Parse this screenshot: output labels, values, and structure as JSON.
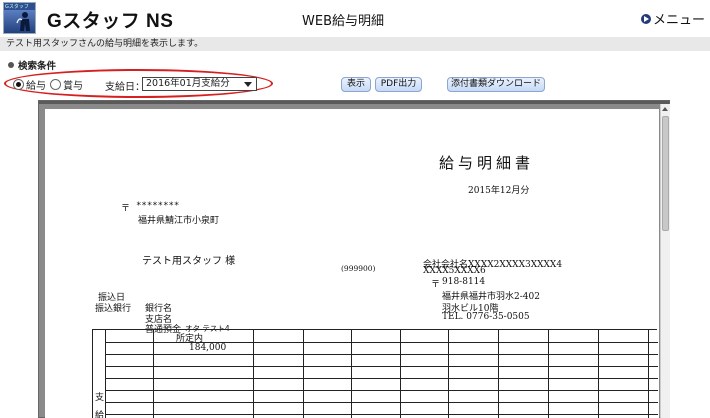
{
  "header": {
    "logo_caption": "Gスタッフ",
    "app_title": "Gスタッフ NS",
    "page_title": "WEB給与明細",
    "menu_label": "メニュー"
  },
  "info_text": "テスト用スタッフさんの給与明細を表示します。",
  "search": {
    "title": "検索条件",
    "radio_salary": "給与",
    "radio_bonus": "賞与",
    "selected": "salary",
    "date_label": "支給日：",
    "date_value": "2016年01月支給分",
    "buttons": {
      "show": "表示",
      "pdf": "PDF出力",
      "download": "添付書類ダウンロード"
    }
  },
  "document": {
    "title": "給与明細書",
    "period": "2015年12月分",
    "postal_mark": "〒",
    "recipient_postal": "********",
    "recipient_address": "福井県鯖江市小泉町",
    "recipient_name": "テスト用スタッフ 様",
    "staff_code": "(999900)",
    "company_name_line1": "会社会社名XXXX2XXXX3XXXX4",
    "company_name_line2": "XXXX5XXXX6",
    "company_postal": "918-8114",
    "company_address1": "福井県福井市羽水2-402",
    "company_address2": "羽水ビル10階",
    "company_tel": "TEL. 0776-35-0505",
    "transfer_date_label": "振込日",
    "transfer_bank_label": "振込銀行",
    "bank_name_label": "銀行名",
    "branch_name_label": "支店名",
    "account_label": "普通預金",
    "account_holder": "オタ テスト4",
    "table_header": "所定内",
    "table_value": "184,000",
    "section_label_1": "支",
    "section_label_2": "給"
  },
  "colors": {
    "highlight": "#d62020",
    "info_bar": "#e8e8e8",
    "button": "#c6d9f5"
  }
}
